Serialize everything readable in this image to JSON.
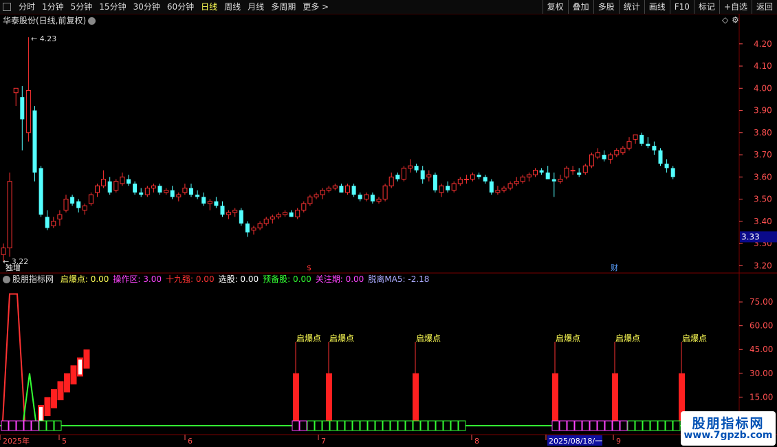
{
  "toolbar": {
    "left_items": [
      "分时",
      "1分钟",
      "5分钟",
      "15分钟",
      "30分钟",
      "60分钟",
      "日线",
      "周线",
      "月线",
      "多周期",
      "更多 >"
    ],
    "active_item": "日线",
    "right_buttons": [
      "复权",
      "叠加",
      "多股",
      "统计",
      "画线",
      "F10",
      "标记",
      "+自选",
      "返回"
    ]
  },
  "price_panel": {
    "title": "华泰股份(日线,前复权)",
    "y_ticks": [
      "4.20",
      "4.10",
      "4.00",
      "3.90",
      "3.80",
      "3.70",
      "3.60",
      "3.50",
      "3.40",
      "3.30",
      "3.20"
    ],
    "current_price": "3.33",
    "high_label": "4.23",
    "low_label": "3.22",
    "markers": [
      {
        "text": "独增",
        "color": "#ffffff"
      },
      {
        "text": "$",
        "color": "#ff3333"
      },
      {
        "text": "财",
        "color": "#5aa0ff"
      }
    ]
  },
  "indicator_panel": {
    "name": "股朋指标网",
    "fields": [
      {
        "label": "启爆点:",
        "value": "0.00",
        "color": "#ffff55"
      },
      {
        "label": "操作区:",
        "value": "3.00",
        "color": "#ff44ff"
      },
      {
        "label": "十九强:",
        "value": "0.00",
        "color": "#ff3333"
      },
      {
        "label": "选股:",
        "value": "0.00",
        "color": "#ffffff"
      },
      {
        "label": "预备股:",
        "value": "0.00",
        "color": "#33ff33"
      },
      {
        "label": "关注期:",
        "value": "0.00",
        "color": "#ff44ff"
      },
      {
        "label": "脱离MA5:",
        "value": "-2.18",
        "color": "#aaaaff"
      }
    ],
    "y_ticks": [
      "75.00",
      "60.00",
      "45.00",
      "30.00",
      "15.00"
    ],
    "signal_label": "启爆点"
  },
  "date_axis": {
    "labels": [
      "2025年",
      "5",
      "6",
      "7",
      "8",
      "2025/08/18/一",
      "9"
    ]
  },
  "watermark": {
    "title": "股朋指标网",
    "url": "www.7gpzb.com"
  },
  "colors": {
    "up": "#ff3232",
    "down": "#54ffff",
    "grid": "#7a0000",
    "axis_text": "#ff5050"
  },
  "chart_data": {
    "type": "candlestick",
    "series_ohlc": [
      [
        3.25,
        3.3,
        3.22,
        3.28
      ],
      [
        3.28,
        3.62,
        3.24,
        3.58
      ],
      [
        3.98,
        4.0,
        3.92,
        4.0
      ],
      [
        3.96,
        4.01,
        3.72,
        3.86
      ],
      [
        3.8,
        4.23,
        3.76,
        3.99
      ],
      [
        3.9,
        3.92,
        3.58,
        3.62
      ],
      [
        3.64,
        3.65,
        3.42,
        3.43
      ],
      [
        3.42,
        3.45,
        3.36,
        3.37
      ],
      [
        3.38,
        3.42,
        3.37,
        3.4
      ],
      [
        3.41,
        3.45,
        3.38,
        3.43
      ],
      [
        3.45,
        3.52,
        3.44,
        3.5
      ],
      [
        3.51,
        3.52,
        3.47,
        3.48
      ],
      [
        3.49,
        3.5,
        3.44,
        3.46
      ],
      [
        3.45,
        3.48,
        3.43,
        3.47
      ],
      [
        3.48,
        3.53,
        3.47,
        3.52
      ],
      [
        3.53,
        3.57,
        3.51,
        3.56
      ],
      [
        3.56,
        3.63,
        3.55,
        3.59
      ],
      [
        3.58,
        3.6,
        3.52,
        3.53
      ],
      [
        3.54,
        3.59,
        3.53,
        3.58
      ],
      [
        3.57,
        3.62,
        3.56,
        3.6
      ],
      [
        3.59,
        3.61,
        3.56,
        3.57
      ],
      [
        3.57,
        3.58,
        3.52,
        3.53
      ],
      [
        3.53,
        3.55,
        3.51,
        3.52
      ],
      [
        3.52,
        3.56,
        3.51,
        3.55
      ],
      [
        3.55,
        3.57,
        3.53,
        3.56
      ],
      [
        3.56,
        3.57,
        3.52,
        3.53
      ],
      [
        3.53,
        3.55,
        3.52,
        3.54
      ],
      [
        3.54,
        3.56,
        3.5,
        3.51
      ],
      [
        3.51,
        3.53,
        3.49,
        3.52
      ],
      [
        3.53,
        3.57,
        3.52,
        3.55
      ],
      [
        3.55,
        3.57,
        3.51,
        3.52
      ],
      [
        3.52,
        3.54,
        3.5,
        3.51
      ],
      [
        3.51,
        3.53,
        3.47,
        3.48
      ],
      [
        3.48,
        3.5,
        3.45,
        3.49
      ],
      [
        3.49,
        3.51,
        3.46,
        3.47
      ],
      [
        3.47,
        3.49,
        3.42,
        3.43
      ],
      [
        3.43,
        3.45,
        3.41,
        3.44
      ],
      [
        3.44,
        3.46,
        3.42,
        3.45
      ],
      [
        3.45,
        3.46,
        3.38,
        3.39
      ],
      [
        3.39,
        3.4,
        3.33,
        3.35
      ],
      [
        3.36,
        3.38,
        3.34,
        3.37
      ],
      [
        3.37,
        3.4,
        3.36,
        3.39
      ],
      [
        3.39,
        3.42,
        3.38,
        3.41
      ],
      [
        3.41,
        3.43,
        3.39,
        3.42
      ],
      [
        3.42,
        3.44,
        3.41,
        3.43
      ],
      [
        3.43,
        3.45,
        3.42,
        3.44
      ],
      [
        3.44,
        3.45,
        3.42,
        3.42
      ],
      [
        3.42,
        3.46,
        3.41,
        3.45
      ],
      [
        3.45,
        3.49,
        3.44,
        3.48
      ],
      [
        3.48,
        3.52,
        3.47,
        3.51
      ],
      [
        3.51,
        3.53,
        3.5,
        3.52
      ],
      [
        3.52,
        3.55,
        3.5,
        3.54
      ],
      [
        3.54,
        3.56,
        3.53,
        3.55
      ],
      [
        3.55,
        3.57,
        3.54,
        3.56
      ],
      [
        3.56,
        3.57,
        3.53,
        3.53
      ],
      [
        3.53,
        3.57,
        3.52,
        3.56
      ],
      [
        3.56,
        3.57,
        3.51,
        3.52
      ],
      [
        3.52,
        3.53,
        3.49,
        3.5
      ],
      [
        3.5,
        3.53,
        3.49,
        3.52
      ],
      [
        3.52,
        3.53,
        3.48,
        3.49
      ],
      [
        3.49,
        3.51,
        3.48,
        3.5
      ],
      [
        3.5,
        3.57,
        3.49,
        3.56
      ],
      [
        3.56,
        3.62,
        3.55,
        3.6
      ],
      [
        3.61,
        3.62,
        3.58,
        3.59
      ],
      [
        3.59,
        3.65,
        3.58,
        3.64
      ],
      [
        3.64,
        3.68,
        3.62,
        3.65
      ],
      [
        3.65,
        3.66,
        3.62,
        3.63
      ],
      [
        3.63,
        3.65,
        3.57,
        3.59
      ],
      [
        3.6,
        3.63,
        3.58,
        3.61
      ],
      [
        3.61,
        3.62,
        3.53,
        3.54
      ],
      [
        3.53,
        3.57,
        3.51,
        3.56
      ],
      [
        3.56,
        3.58,
        3.53,
        3.54
      ],
      [
        3.54,
        3.58,
        3.53,
        3.57
      ],
      [
        3.57,
        3.6,
        3.56,
        3.59
      ],
      [
        3.59,
        3.61,
        3.57,
        3.59
      ],
      [
        3.59,
        3.62,
        3.58,
        3.61
      ],
      [
        3.61,
        3.62,
        3.59,
        3.6
      ],
      [
        3.6,
        3.61,
        3.57,
        3.58
      ],
      [
        3.58,
        3.59,
        3.52,
        3.53
      ],
      [
        3.53,
        3.56,
        3.52,
        3.54
      ],
      [
        3.54,
        3.56,
        3.53,
        3.55
      ],
      [
        3.55,
        3.58,
        3.54,
        3.57
      ],
      [
        3.57,
        3.6,
        3.56,
        3.58
      ],
      [
        3.58,
        3.61,
        3.57,
        3.6
      ],
      [
        3.6,
        3.62,
        3.58,
        3.61
      ],
      [
        3.61,
        3.64,
        3.6,
        3.63
      ],
      [
        3.63,
        3.64,
        3.61,
        3.62
      ],
      [
        3.62,
        3.65,
        3.6,
        3.59
      ],
      [
        3.59,
        3.62,
        3.51,
        3.58
      ],
      [
        3.58,
        3.61,
        3.57,
        3.59
      ],
      [
        3.6,
        3.65,
        3.59,
        3.64
      ],
      [
        3.63,
        3.65,
        3.61,
        3.63
      ],
      [
        3.62,
        3.64,
        3.6,
        3.61
      ],
      [
        3.62,
        3.66,
        3.61,
        3.65
      ],
      [
        3.65,
        3.71,
        3.64,
        3.7
      ],
      [
        3.69,
        3.73,
        3.68,
        3.71
      ],
      [
        3.7,
        3.72,
        3.67,
        3.68
      ],
      [
        3.68,
        3.71,
        3.66,
        3.7
      ],
      [
        3.7,
        3.73,
        3.69,
        3.72
      ],
      [
        3.71,
        3.74,
        3.7,
        3.73
      ],
      [
        3.73,
        3.78,
        3.72,
        3.76
      ],
      [
        3.77,
        3.79,
        3.75,
        3.79
      ],
      [
        3.79,
        3.8,
        3.74,
        3.75
      ],
      [
        3.75,
        3.78,
        3.73,
        3.74
      ],
      [
        3.74,
        3.76,
        3.7,
        3.72
      ],
      [
        3.72,
        3.73,
        3.65,
        3.66
      ],
      [
        3.66,
        3.68,
        3.62,
        3.64
      ],
      [
        3.64,
        3.65,
        3.59,
        3.6
      ]
    ],
    "ylim_price": [
      3.17,
      4.28
    ],
    "indicator": {
      "ylim": [
        0,
        85
      ],
      "stair_values": [
        10,
        15,
        20,
        25,
        30,
        35,
        40,
        45
      ],
      "signal_bars_value": 30,
      "early_peak_red": 80,
      "early_peak_green": 30
    }
  }
}
